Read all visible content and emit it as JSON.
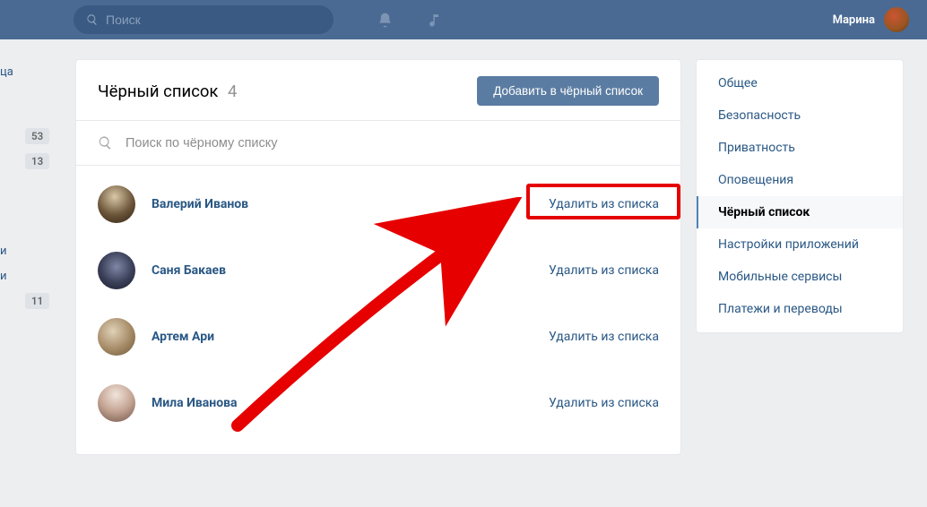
{
  "topbar": {
    "search_placeholder": "Поиск",
    "username": "Марина"
  },
  "left_fragment": {
    "item1": "ца",
    "item2": "и",
    "item3": "и",
    "badge1": "53",
    "badge2": "13",
    "badge3": "11"
  },
  "main": {
    "title": "Чёрный список",
    "count": "4",
    "add_button": "Добавить в чёрный список",
    "search_placeholder": "Поиск по чёрному списку",
    "rows": [
      {
        "name": "Валерий Иванов",
        "action": "Удалить из списка"
      },
      {
        "name": "Саня Бакаев",
        "action": "Удалить из списка"
      },
      {
        "name": "Артем Ари",
        "action": "Удалить из списка"
      },
      {
        "name": "Мила Иванова",
        "action": "Удалить из списка"
      }
    ]
  },
  "sidebar": {
    "items": [
      "Общее",
      "Безопасность",
      "Приватность",
      "Оповещения",
      "Чёрный список",
      "Настройки приложений",
      "Мобильные сервисы",
      "Платежи и переводы"
    ],
    "active_index": 4
  }
}
